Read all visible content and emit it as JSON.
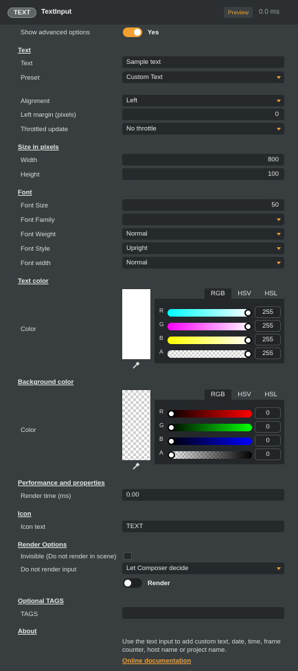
{
  "header": {
    "badge": "TEXT",
    "title": "TextInput",
    "preview": "Preview",
    "time": "0.0 ms"
  },
  "advanced": {
    "label": "Show advanced options",
    "value": "Yes"
  },
  "text_section": {
    "title": "Text",
    "text_label": "Text",
    "text_value": "Sample text",
    "preset_label": "Preset",
    "preset_value": "Custom Text",
    "alignment_label": "Alignment",
    "alignment_value": "Left",
    "margin_label": "Left margin (pixels)",
    "margin_value": "0",
    "throttle_label": "Throttled update",
    "throttle_value": "No throttle"
  },
  "size_section": {
    "title": "Size in pixels",
    "width_label": "Width",
    "width_value": "800",
    "height_label": "Height",
    "height_value": "100"
  },
  "font_section": {
    "title": "Font",
    "size_label": "Font Size",
    "size_value": "50",
    "family_label": "Font Family",
    "family_value": "",
    "weight_label": "Font Weight",
    "weight_value": "Normal",
    "style_label": "Font Style",
    "style_value": "Upright",
    "width_label": "Font width",
    "width_value": "Normal"
  },
  "text_color": {
    "title": "Text color",
    "label": "Color",
    "tabs": [
      "RGB",
      "HSV",
      "HSL"
    ],
    "channels": [
      {
        "name": "R",
        "value": "255"
      },
      {
        "name": "G",
        "value": "255"
      },
      {
        "name": "B",
        "value": "255"
      },
      {
        "name": "A",
        "value": "255"
      }
    ],
    "swatch": "#ffffff"
  },
  "bg_color": {
    "title": "Background color",
    "label": "Color",
    "tabs": [
      "RGB",
      "HSV",
      "HSL"
    ],
    "channels": [
      {
        "name": "R",
        "value": "0"
      },
      {
        "name": "G",
        "value": "0"
      },
      {
        "name": "B",
        "value": "0"
      },
      {
        "name": "A",
        "value": "0"
      }
    ],
    "swatch": "transparent"
  },
  "performance": {
    "title": "Performance and properties",
    "render_label": "Render time (ms)",
    "render_value": "0.00"
  },
  "icon": {
    "title": "Icon",
    "label": "Icon text",
    "value": "TEXT"
  },
  "render_options": {
    "title": "Render Options",
    "invisible_label": "Invisible (Do not render in scene)",
    "noinput_label": "Do not render input",
    "noinput_value": "Let Composer decide",
    "render_toggle_label": "Render"
  },
  "tags": {
    "title": "Optional TAGS",
    "label": "TAGS",
    "value": ""
  },
  "about": {
    "title": "About",
    "line1": "Use the text input to add custom text, date, time, frame",
    "line2": "counter, host name or project name.",
    "link": "Online documentation"
  },
  "colors": {
    "accent": "#f0a030",
    "panel": "#383d3f",
    "field": "#26292b",
    "header": "#2b2f31"
  }
}
